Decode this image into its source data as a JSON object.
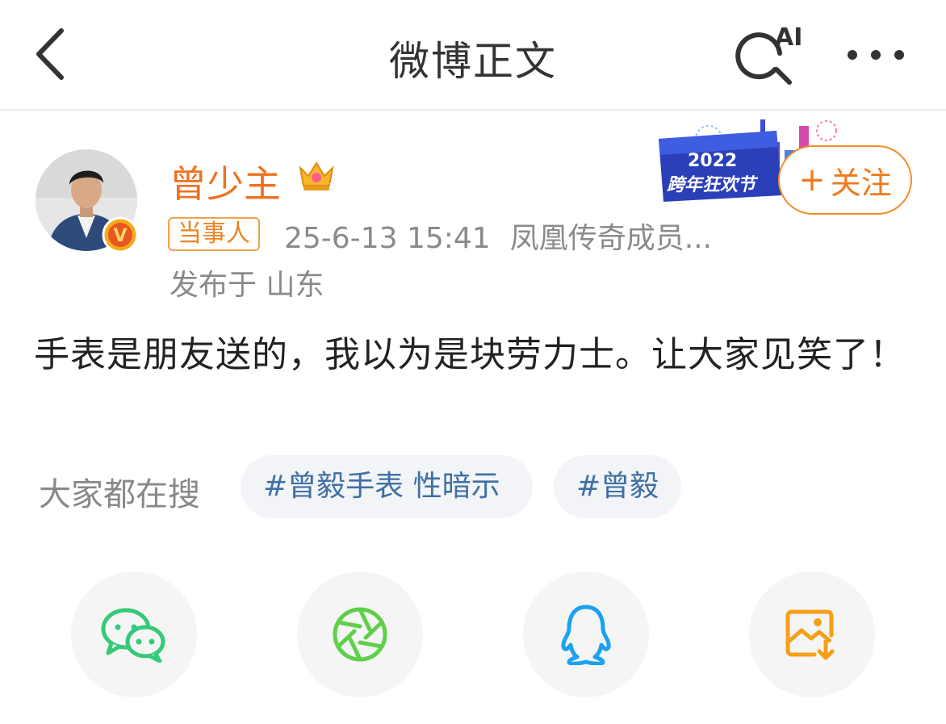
{
  "nav": {
    "title": "微博正文",
    "ai_label": "AI"
  },
  "post": {
    "author": "曾少主",
    "role_tag": "当事人",
    "datetime": "25-6-13 15:41",
    "group": "凤凰传奇成员...",
    "location": "发布于 山东",
    "follow_label": "关注",
    "content": "手表是朋友送的，我以为是块劳力士。让大家见笑了！",
    "verify_letter": "V",
    "banner_year": "2022",
    "banner_text": "跨年狂欢节"
  },
  "trending": {
    "label": "大家都在搜",
    "tags": [
      "#曾毅手表 性暗示",
      "#曾毅"
    ]
  },
  "share": {
    "items": [
      "wechat-icon",
      "moments-icon",
      "qq-icon",
      "save-image-icon"
    ]
  },
  "colors": {
    "accent": "#f07a1c",
    "username": "#ee7221",
    "tag_text": "#3f6fa3",
    "wechat_green": "#36c97a",
    "moments_green": "#5fcf4a",
    "qq_blue": "#1ba1f2",
    "save_orange": "#f5a018"
  }
}
